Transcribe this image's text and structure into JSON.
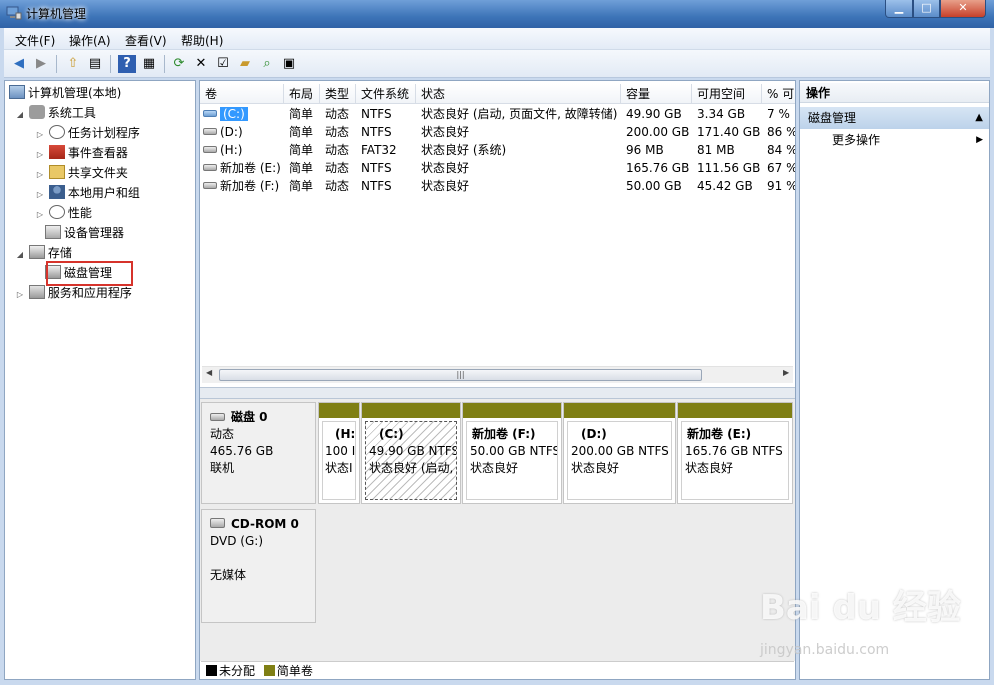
{
  "window": {
    "title": "计算机管理"
  },
  "menu": [
    "文件(F)",
    "操作(A)",
    "查看(V)",
    "帮助(H)"
  ],
  "tree": {
    "root": "计算机管理(本地)",
    "system_tools": "系统工具",
    "task_scheduler": "任务计划程序",
    "event_viewer": "事件查看器",
    "shared_folders": "共享文件夹",
    "local_users": "本地用户和组",
    "performance": "性能",
    "device_manager": "设备管理器",
    "storage": "存储",
    "disk_management": "磁盘管理",
    "services_apps": "服务和应用程序"
  },
  "columns": [
    "卷",
    "布局",
    "类型",
    "文件系统",
    "状态",
    "容量",
    "可用空间",
    "% 可"
  ],
  "volumes": [
    {
      "name": "(C:)",
      "layout": "简单",
      "type": "动态",
      "fs": "NTFS",
      "status": "状态良好 (启动, 页面文件, 故障转储)",
      "capacity": "49.90 GB",
      "free": "3.34 GB",
      "pct": "7 %"
    },
    {
      "name": "(D:)",
      "layout": "简单",
      "type": "动态",
      "fs": "NTFS",
      "status": "状态良好",
      "capacity": "200.00 GB",
      "free": "171.40 GB",
      "pct": "86 %"
    },
    {
      "name": "(H:)",
      "layout": "简单",
      "type": "动态",
      "fs": "FAT32",
      "status": "状态良好 (系统)",
      "capacity": "96 MB",
      "free": "81 MB",
      "pct": "84 %"
    },
    {
      "name": "新加卷 (E:)",
      "layout": "简单",
      "type": "动态",
      "fs": "NTFS",
      "status": "状态良好",
      "capacity": "165.76 GB",
      "free": "111.56 GB",
      "pct": "67 %"
    },
    {
      "name": "新加卷 (F:)",
      "layout": "简单",
      "type": "动态",
      "fs": "NTFS",
      "status": "状态良好",
      "capacity": "50.00 GB",
      "free": "45.42 GB",
      "pct": "91 %"
    }
  ],
  "disk0": {
    "name": "磁盘 0",
    "type": "动态",
    "size": "465.76 GB",
    "state": "联机",
    "partitions": [
      {
        "label": "(H:",
        "size": "100 I",
        "status": "状态I"
      },
      {
        "label": "(C:)",
        "size": "49.90 GB NTFS",
        "status": "状态良好 (启动,"
      },
      {
        "label": "新加卷  (F:)",
        "size": "50.00 GB NTFS",
        "status": "状态良好"
      },
      {
        "label": "(D:)",
        "size": "200.00 GB NTFS",
        "status": "状态良好"
      },
      {
        "label": "新加卷  (E:)",
        "size": "165.76 GB NTFS",
        "status": "状态良好"
      }
    ]
  },
  "cdrom": {
    "name": "CD-ROM 0",
    "drive": "DVD (G:)",
    "media": "无媒体"
  },
  "legend": {
    "unallocated": "未分配",
    "simple": "简单卷",
    "unallocated_color": "#000000",
    "simple_color": "#7f7f14"
  },
  "actions": {
    "header": "操作",
    "section": "磁盘管理",
    "more": "更多操作"
  },
  "watermark": {
    "brand": "Bai du 经验",
    "url": "jingyan.baidu.com"
  }
}
